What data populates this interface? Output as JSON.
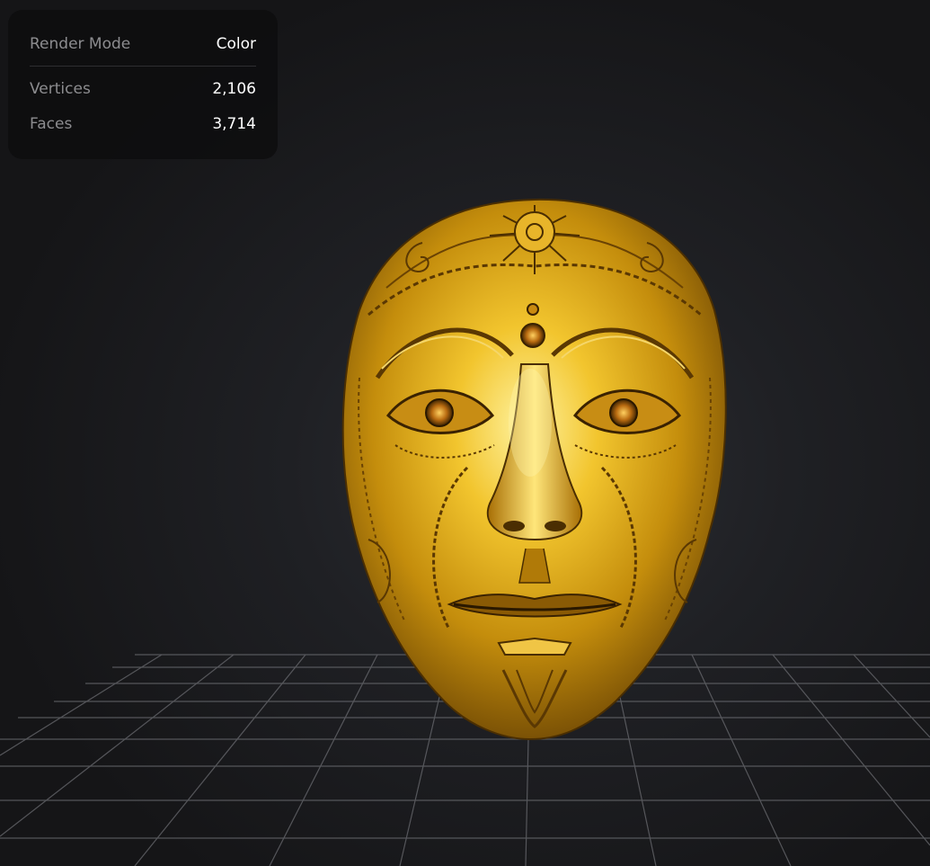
{
  "info_panel": {
    "render_mode": {
      "label": "Render Mode",
      "value": "Color"
    },
    "vertices": {
      "label": "Vertices",
      "value": "2,106"
    },
    "faces": {
      "label": "Faces",
      "value": "3,714"
    }
  },
  "model": {
    "subject": "golden ornate face mask",
    "material_color": "#d9a520"
  },
  "viewport": {
    "background": "#1e1f22",
    "grid_color": "#6f7075"
  }
}
